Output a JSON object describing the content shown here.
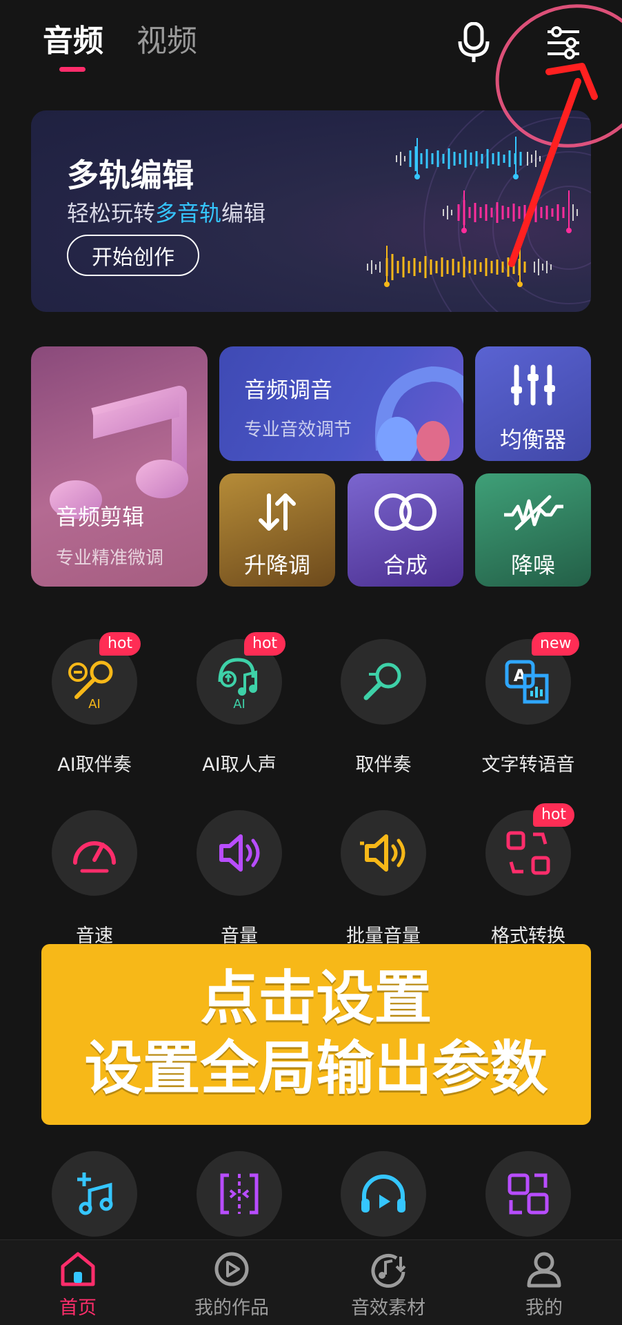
{
  "tabs": {
    "active": "音频",
    "inactive": "视频"
  },
  "banner": {
    "title": "多轨编辑",
    "sub_prefix": "轻松玩转",
    "sub_highlight": "多音轨",
    "sub_suffix": "编辑",
    "button": "开始创作"
  },
  "cards": {
    "edit": {
      "title": "音频剪辑",
      "sub": "专业精准微调"
    },
    "tune": {
      "title": "音频调音",
      "sub": "专业音效调节"
    },
    "eq": {
      "title": "均衡器"
    },
    "pitch": {
      "title": "升降调"
    },
    "mix": {
      "title": "合成"
    },
    "denoise": {
      "title": "降噪"
    }
  },
  "tools": [
    {
      "label": "AI取伴奏",
      "badge": "hot",
      "icon": "ai-mic-icon"
    },
    {
      "label": "AI取人声",
      "badge": "hot",
      "icon": "ai-voice-icon"
    },
    {
      "label": "取伴奏",
      "badge": "",
      "icon": "mic-icon"
    },
    {
      "label": "文字转语音",
      "badge": "new",
      "icon": "text-to-speech-icon"
    },
    {
      "label": "音速",
      "badge": "",
      "icon": "speedometer-icon"
    },
    {
      "label": "音量",
      "badge": "",
      "icon": "volume-icon"
    },
    {
      "label": "批量音量",
      "badge": "",
      "icon": "batch-volume-icon"
    },
    {
      "label": "格式转换",
      "badge": "hot",
      "icon": "format-convert-icon"
    }
  ],
  "overlay": {
    "line1": "点击设置",
    "line2": "设置全局输出参数"
  },
  "nav": [
    {
      "label": "首页",
      "icon": "home-icon"
    },
    {
      "label": "我的作品",
      "icon": "play-icon"
    },
    {
      "label": "音效素材",
      "icon": "music-download-icon"
    },
    {
      "label": "我的",
      "icon": "user-icon"
    }
  ],
  "colors": {
    "accent": "#ff2d6b",
    "overlay": "#f7b818",
    "annotation": "#ff2020"
  }
}
